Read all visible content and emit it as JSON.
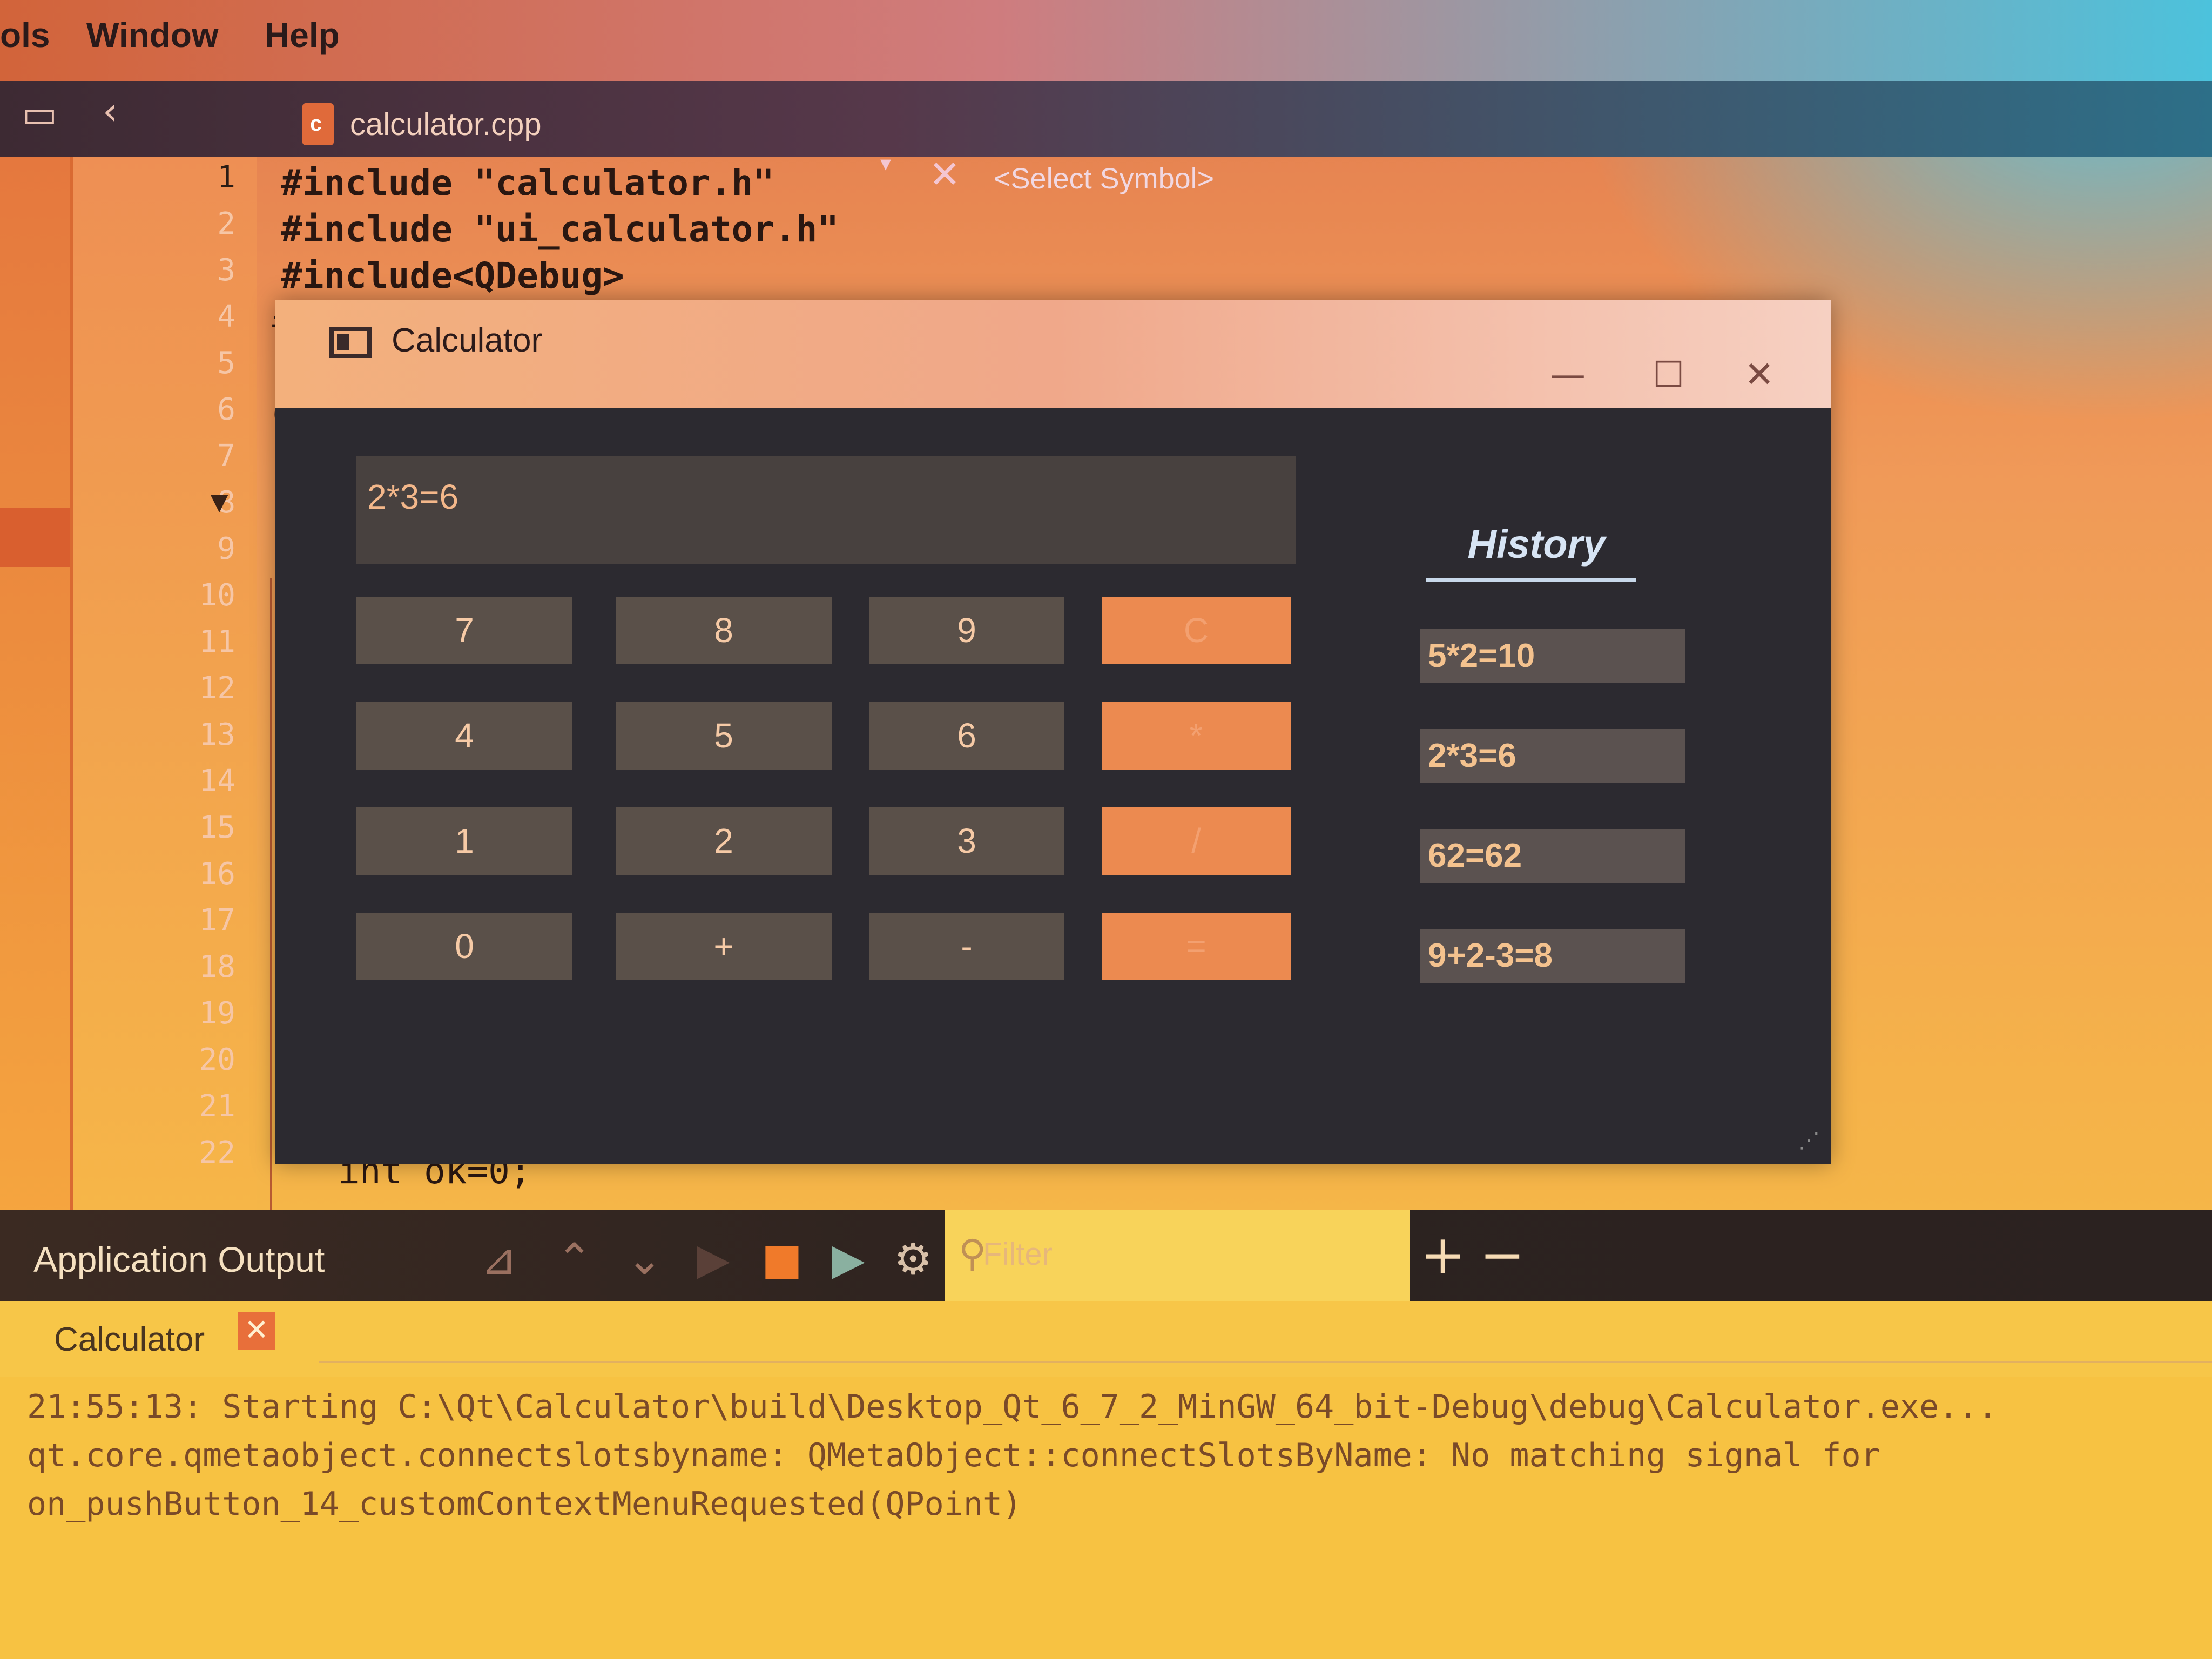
{
  "menu": {
    "items": [
      "ols",
      "Window",
      "Help"
    ]
  },
  "editor": {
    "file_tab": "calculator.cpp",
    "symbol_selector": "<Select Symbol>",
    "line_numbers": [
      "1",
      "2",
      "3",
      "4",
      "5",
      "6",
      "7",
      "8",
      "9",
      "10",
      "11",
      "12",
      "13",
      "14",
      "15",
      "16",
      "17",
      "18",
      "19",
      "20",
      "21",
      "22"
    ],
    "code": [
      "#include \"calculator.h\"",
      "#include \"ui_calculator.h\"",
      "#include<QDebug>",
      "#",
      "C",
      "{",
      "int ok=0;"
    ]
  },
  "calculator": {
    "window_title": "Calculator",
    "display": "2*3=6",
    "buttons": [
      "7",
      "8",
      "9",
      "C",
      "4",
      "5",
      "6",
      "*",
      "1",
      "2",
      "3",
      "/",
      "0",
      "+",
      "-",
      "="
    ],
    "history_title": "History",
    "history": [
      "5*2=10",
      "2*3=6",
      "62=62",
      "9+2-3=8"
    ]
  },
  "output": {
    "title": "Application Output",
    "filter_placeholder": "Filter",
    "tab_label": "Calculator",
    "lines": [
      "21:55:13: Starting C:\\Qt\\Calculator\\build\\Desktop_Qt_6_7_2_MinGW_64_bit-Debug\\debug\\Calculator.exe...",
      "qt.core.qmetaobject.connectslotsbyname: QMetaObject::connectSlotsByName: No matching signal for",
      "on_pushButton_14_customContextMenuRequested(QPoint)"
    ]
  },
  "colors": {
    "accent": "#ec8a50",
    "calc_bg": "#2c2a30",
    "button": "#5a5049"
  }
}
